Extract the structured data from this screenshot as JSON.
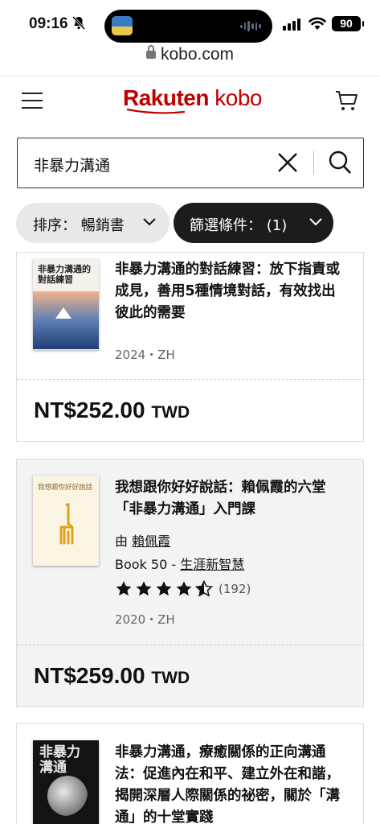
{
  "status": {
    "time": "09:16",
    "battery": "90"
  },
  "browser": {
    "url": "kobo.com"
  },
  "header": {
    "logo_rakuten": "Rakuten",
    "logo_kobo": " kobo",
    "brand_color": "#bf0000"
  },
  "search": {
    "query": "非暴力溝通"
  },
  "filters": {
    "sort_label": "排序： 暢銷書",
    "filter_label": "篩選條件： (1)"
  },
  "results": [
    {
      "title": "非暴力溝通的對話練習：放下指責或成見，善用5種情境對話，有效找出彼此的需要",
      "year_lang": "2024・ZH",
      "price": "NT$252.00",
      "currency": "TWD",
      "cover_title": "非暴力溝通的對話練習"
    },
    {
      "title": "我想跟你好好說話：賴佩霞的六堂「非暴力溝通」入門課",
      "author_prefix": "由 ",
      "author": "賴佩霞",
      "series_prefix": "Book 50 - ",
      "series": "生涯新智慧",
      "rating_count": "(192)",
      "rating": 4.5,
      "year_lang": "2020・ZH",
      "price": "NT$259.00",
      "currency": "TWD",
      "cover_title": "我想跟你好好說話"
    },
    {
      "title": "非暴力溝通，療癒關係的正向溝通法：促進內在和平、建立外在和諧，揭開深層人際關係的祕密，關於「溝通」的十堂實踐",
      "cover_title": "非暴力溝通"
    }
  ]
}
